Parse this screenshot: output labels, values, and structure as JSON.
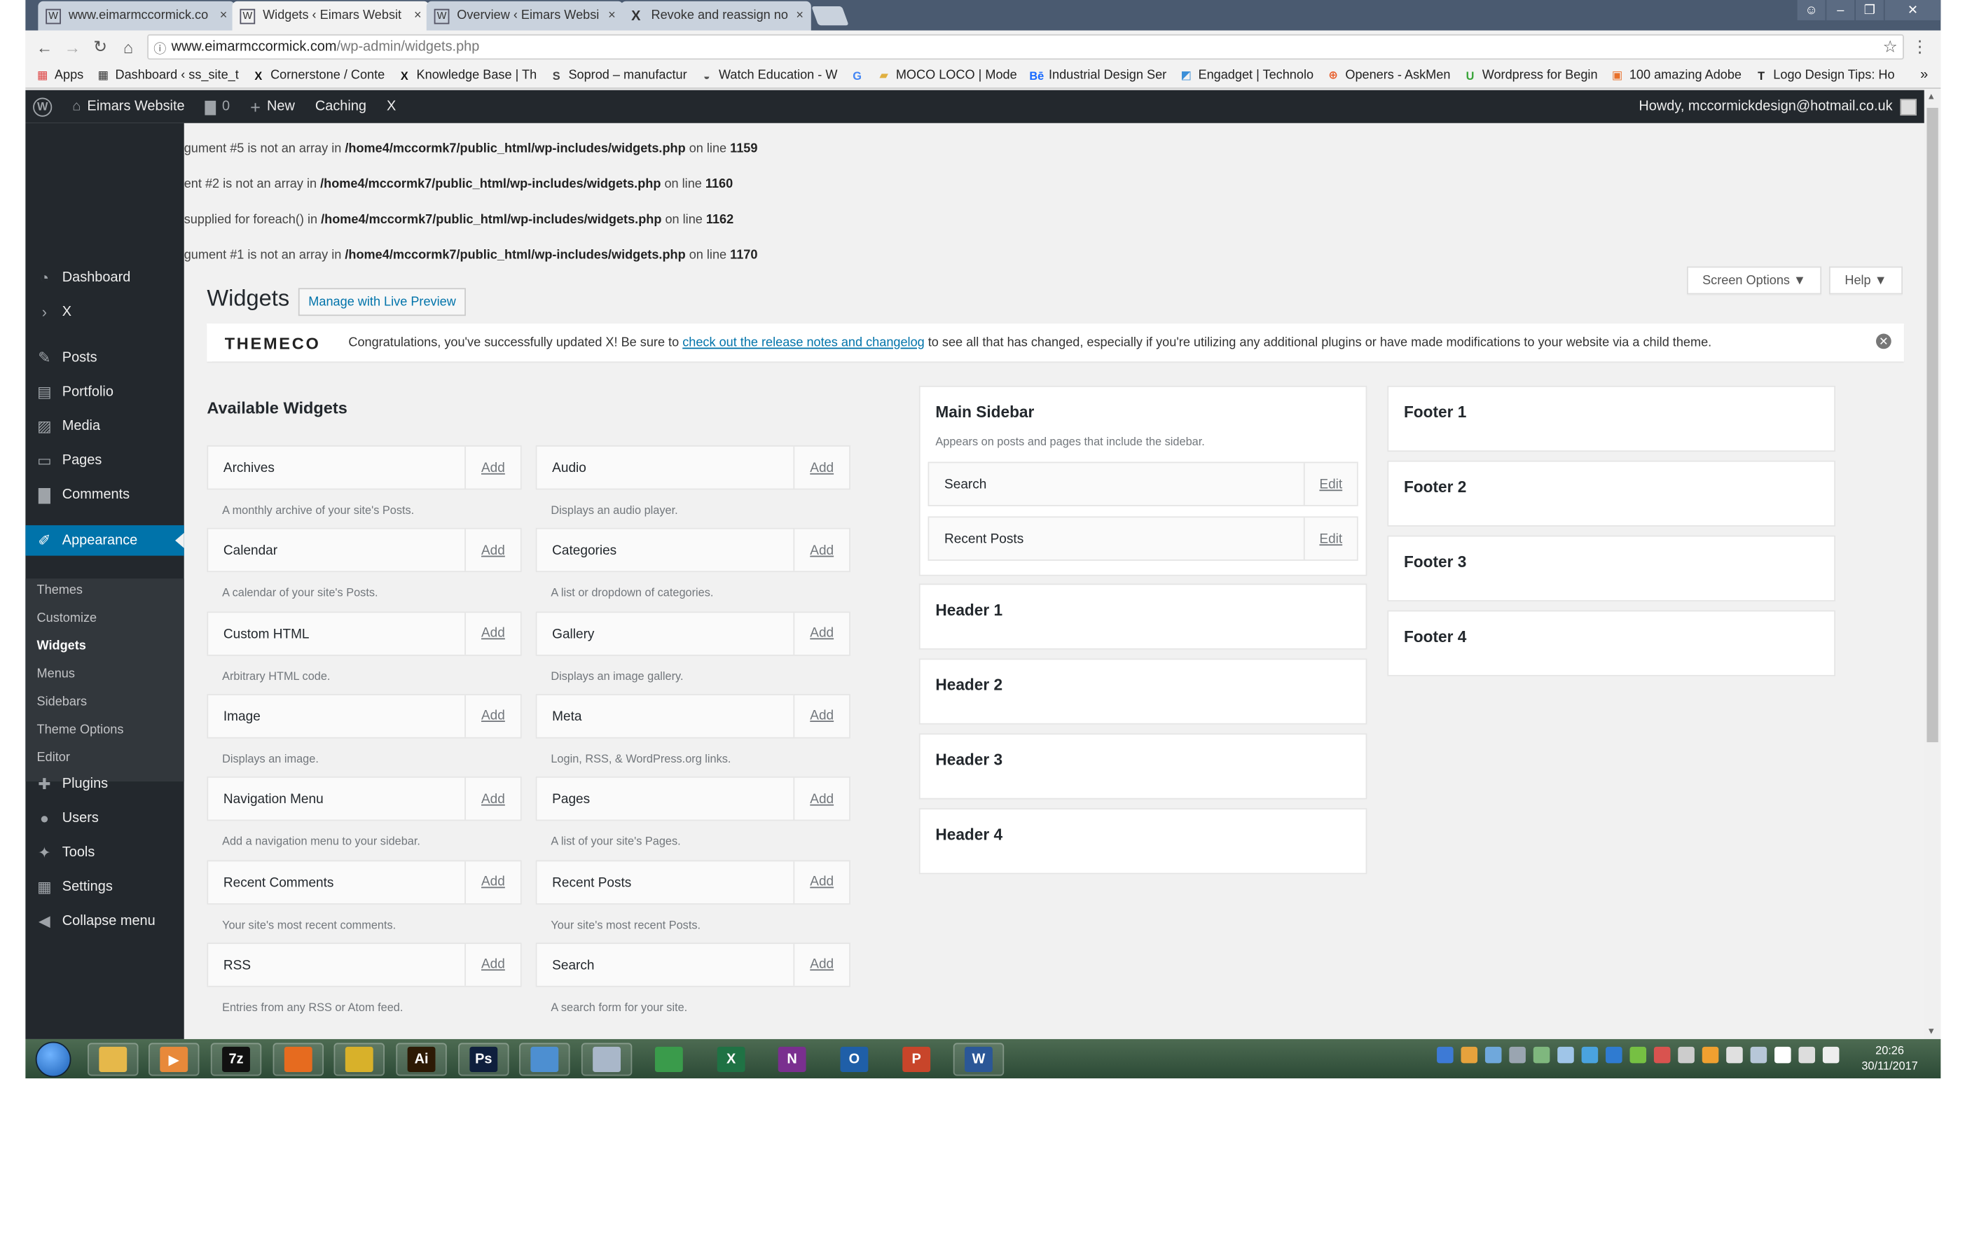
{
  "browser": {
    "tabs": [
      {
        "icon": "wordpress-icon",
        "title": "www.eimarmccormick.co",
        "active": false
      },
      {
        "icon": "wordpress-icon",
        "title": "Widgets ‹ Eimars Websit",
        "active": true
      },
      {
        "icon": "wordpress-icon",
        "title": "Overview ‹ Eimars Websi",
        "active": false
      },
      {
        "icon": "x-icon",
        "title": "Revoke and reassign no",
        "active": false
      }
    ],
    "tab_close": "×",
    "url_domain": "www.eimarmccormick.com",
    "url_path": "/wp-admin/widgets.php",
    "bookmarks": [
      {
        "label": "Apps",
        "icon": "apps-icon"
      },
      {
        "label": "Dashboard ‹ ss_site_t",
        "icon": "wordpress-icon"
      },
      {
        "label": "Cornerstone / Conte",
        "icon": "x-icon"
      },
      {
        "label": "Knowledge Base | Th",
        "icon": "x-icon"
      },
      {
        "label": "Soprod – manufactur",
        "icon": "s-icon"
      },
      {
        "label": "Watch Education - W",
        "icon": "watch-icon"
      },
      {
        "label": "",
        "icon": "google-icon"
      },
      {
        "label": "MOCO LOCO | Mode",
        "icon": "folder-icon"
      },
      {
        "label": "Industrial Design Ser",
        "icon": "behance-icon"
      },
      {
        "label": "Engadget | Technolo",
        "icon": "engadget-icon"
      },
      {
        "label": "Openers - AskMen",
        "icon": "plus-circle-icon"
      },
      {
        "label": "Wordpress for Begin",
        "icon": "u-icon"
      },
      {
        "label": "100 amazing Adobe",
        "icon": "bookmark-icon"
      },
      {
        "label": "Logo Design Tips: Ho",
        "icon": "t-icon"
      }
    ],
    "bookmarks_more": "»"
  },
  "adminbar": {
    "site_name": "Eimars Website",
    "comments_count": "0",
    "new_label": "New",
    "caching_label": "Caching",
    "x_label": "X",
    "howdy": "Howdy, mccormickdesign@hotmail.co.uk"
  },
  "menu": {
    "items": [
      {
        "label": "Dashboard",
        "icon": "dashboard-icon"
      },
      {
        "label": "X",
        "icon": "chevron-right-icon"
      },
      {
        "label": "Posts",
        "icon": "pin-icon"
      },
      {
        "label": "Portfolio",
        "icon": "portfolio-icon"
      },
      {
        "label": "Media",
        "icon": "media-icon"
      },
      {
        "label": "Pages",
        "icon": "pages-icon"
      },
      {
        "label": "Comments",
        "icon": "comment-icon"
      },
      {
        "label": "Appearance",
        "icon": "brush-icon"
      },
      {
        "label": "Plugins",
        "icon": "plugin-icon"
      },
      {
        "label": "Users",
        "icon": "user-icon"
      },
      {
        "label": "Tools",
        "icon": "wrench-icon"
      },
      {
        "label": "Settings",
        "icon": "settings-icon"
      },
      {
        "label": "Collapse menu",
        "icon": "collapse-icon"
      }
    ],
    "submenu": [
      "Themes",
      "Customize",
      "Widgets",
      "Menus",
      "Sidebars",
      "Theme Options",
      "Editor"
    ]
  },
  "errors": [
    {
      "pre": "gument #5 is not an array in ",
      "file": "/home4/mccormk7/public_html/wp-includes/widgets.php",
      "mid": " on line ",
      "line": "1159"
    },
    {
      "pre": "ent #2 is not an array in ",
      "file": "/home4/mccormk7/public_html/wp-includes/widgets.php",
      "mid": " on line ",
      "line": "1160"
    },
    {
      "pre": "supplied for foreach() in ",
      "file": "/home4/mccormk7/public_html/wp-includes/widgets.php",
      "mid": " on line ",
      "line": "1162"
    },
    {
      "pre": "gument #1 is not an array in ",
      "file": "/home4/mccormk7/public_html/wp-includes/widgets.php",
      "mid": " on line ",
      "line": "1170"
    }
  ],
  "screen_options": "Screen Options ▼",
  "help": "Help ▼",
  "page_title": "Widgets",
  "live_preview": "Manage with Live Preview",
  "notice": {
    "logo": "THEMECO",
    "text_before": "Congratulations, you've successfully updated X! Be sure to ",
    "link": "check out the release notes and changelog",
    "text_after": " to see all that has changed, especially if you're utilizing any additional plugins or have made modifications to your website via a child theme."
  },
  "available_title": "Available Widgets",
  "add_label": "Add",
  "edit_label": "Edit",
  "widgets": [
    {
      "name": "Archives",
      "desc": "A monthly archive of your site's Posts."
    },
    {
      "name": "Audio",
      "desc": "Displays an audio player."
    },
    {
      "name": "Calendar",
      "desc": "A calendar of your site's Posts."
    },
    {
      "name": "Categories",
      "desc": "A list or dropdown of categories."
    },
    {
      "name": "Custom HTML",
      "desc": "Arbitrary HTML code."
    },
    {
      "name": "Gallery",
      "desc": "Displays an image gallery."
    },
    {
      "name": "Image",
      "desc": "Displays an image."
    },
    {
      "name": "Meta",
      "desc": "Login, RSS, & WordPress.org links."
    },
    {
      "name": "Navigation Menu",
      "desc": "Add a navigation menu to your sidebar."
    },
    {
      "name": "Pages",
      "desc": "A list of your site's Pages."
    },
    {
      "name": "Recent Comments",
      "desc": "Your site's most recent comments."
    },
    {
      "name": "Recent Posts",
      "desc": "Your site's most recent Posts."
    },
    {
      "name": "RSS",
      "desc": "Entries from any RSS or Atom feed."
    },
    {
      "name": "Search",
      "desc": "A search form for your site."
    }
  ],
  "main_sidebar": {
    "title": "Main Sidebar",
    "desc": "Appears on posts and pages that include the sidebar.",
    "widgets": [
      "Search",
      "Recent Posts"
    ]
  },
  "header_areas": [
    "Header 1",
    "Header 2",
    "Header 3",
    "Header 4"
  ],
  "footer_areas": [
    "Footer 1",
    "Footer 2",
    "Footer 3",
    "Footer 4"
  ],
  "taskbar": {
    "apps": [
      {
        "icon": "file-explorer-icon",
        "glyph": "",
        "color": "#e6b84a"
      },
      {
        "icon": "media-player-icon",
        "glyph": "▶",
        "color": "#e8893a"
      },
      {
        "icon": "7zip-icon",
        "glyph": "7z",
        "color": "#111111"
      },
      {
        "icon": "firefox-icon",
        "glyph": "",
        "color": "#e66b1f"
      },
      {
        "icon": "chrome-icon",
        "glyph": "",
        "color": "#d8b12a"
      },
      {
        "icon": "illustrator-icon",
        "glyph": "Ai",
        "color": "#2d1a05"
      },
      {
        "icon": "photoshop-icon",
        "glyph": "Ps",
        "color": "#0f1f3d"
      },
      {
        "icon": "window-icon",
        "glyph": "",
        "color": "#4d8fd1"
      },
      {
        "icon": "calculator-icon",
        "glyph": "",
        "color": "#a9b7c9"
      },
      {
        "icon": "google-chrome-icon",
        "glyph": "",
        "color": "#3a9b4b"
      },
      {
        "icon": "excel-icon",
        "glyph": "X",
        "color": "#1f7244"
      },
      {
        "icon": "onenote-icon",
        "glyph": "N",
        "color": "#7a2f8f"
      },
      {
        "icon": "outlook-icon",
        "glyph": "O",
        "color": "#1f5fa8"
      },
      {
        "icon": "powerpoint-icon",
        "glyph": "P",
        "color": "#c8452a"
      },
      {
        "icon": "word-icon",
        "glyph": "W",
        "color": "#2b5797"
      }
    ],
    "time": "20:26",
    "date": "30/11/2017"
  }
}
